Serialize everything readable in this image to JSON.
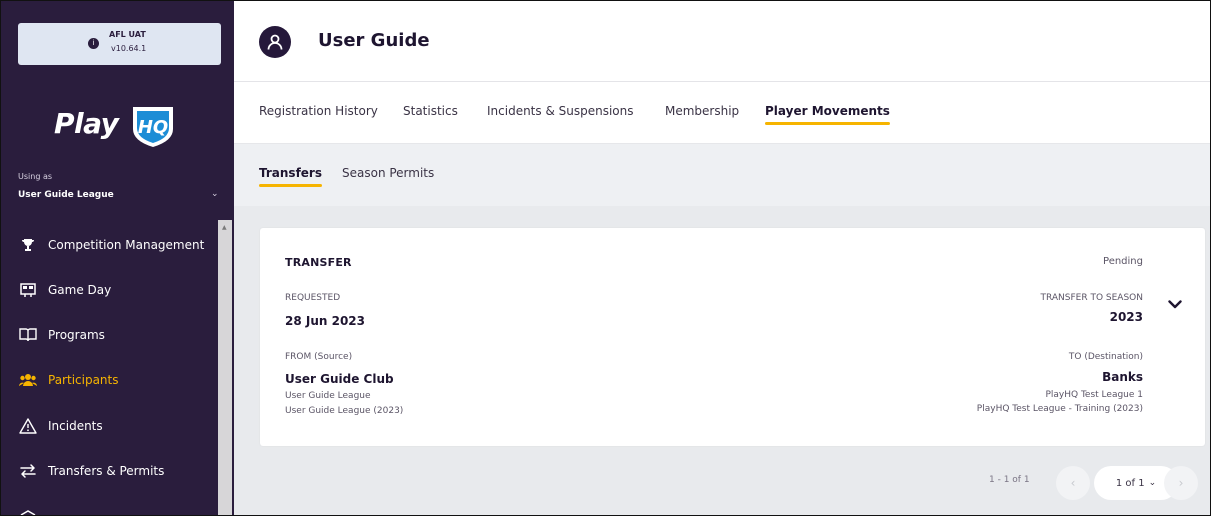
{
  "environment": {
    "name": "AFL UAT",
    "version": "v10.64.1"
  },
  "brand": {
    "logo_text": "Play",
    "logo_badge": "HQ"
  },
  "context": {
    "using_label": "Using as",
    "selected_league": "User Guide League"
  },
  "sidebar": {
    "items": [
      {
        "label": "Competition Management",
        "icon": "trophy-icon"
      },
      {
        "label": "Game Day",
        "icon": "scoreboard-icon"
      },
      {
        "label": "Programs",
        "icon": "book-icon"
      },
      {
        "label": "Participants",
        "icon": "people-icon",
        "active": true
      },
      {
        "label": "Incidents",
        "icon": "warning-icon"
      },
      {
        "label": "Transfers & Permits",
        "icon": "transfer-icon"
      }
    ]
  },
  "header": {
    "title": "User Guide"
  },
  "tabs": [
    {
      "label": "Registration History"
    },
    {
      "label": "Statistics"
    },
    {
      "label": "Incidents & Suspensions"
    },
    {
      "label": "Membership"
    },
    {
      "label": "Player Movements",
      "active": true
    }
  ],
  "subtabs": [
    {
      "label": "Transfers",
      "active": true
    },
    {
      "label": "Season Permits"
    }
  ],
  "transfer_card": {
    "type": "TRANSFER",
    "status": "Pending",
    "requested_label": "REQUESTED",
    "requested_date": "28 Jun 2023",
    "season_label": "TRANSFER TO SEASON",
    "season_value": "2023",
    "from_label": "FROM (Source)",
    "from_club": "User Guide Club",
    "from_league": "User Guide League",
    "from_competition": "User Guide League (2023)",
    "to_label": "TO (Destination)",
    "to_club": "Banks",
    "to_league": "PlayHQ Test League 1",
    "to_competition": "PlayHQ Test League - Training (2023)"
  },
  "pagination": {
    "range": "1 - 1 of 1",
    "page_select": "1 of 1"
  },
  "colors": {
    "sidebar_bg": "#2a1d3d",
    "accent": "#f6b400",
    "active_nav": "#f6b400"
  }
}
